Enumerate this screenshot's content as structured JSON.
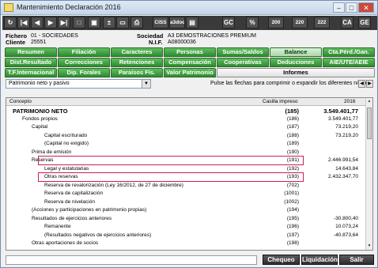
{
  "window": {
    "title": "Mantenimiento Declaración 2016",
    "min": "–",
    "max": "□",
    "close": "✕"
  },
  "toolbar": [
    {
      "name": "refresh-icon",
      "glyph": "↻"
    },
    {
      "name": "first-record-icon",
      "glyph": "|◀"
    },
    {
      "name": "prev-record-icon",
      "glyph": "◀"
    },
    {
      "name": "next-record-icon",
      "glyph": "▶"
    },
    {
      "name": "last-record-icon",
      "glyph": "▶|"
    },
    {
      "name": "new-document-icon",
      "glyph": "□"
    },
    {
      "name": "save-icon",
      "glyph": "▣"
    },
    {
      "name": "add-remove-icon",
      "glyph": "±"
    },
    {
      "name": "delete-icon",
      "glyph": "▭"
    },
    {
      "name": "print-icon",
      "glyph": "⎙"
    },
    {
      "name": "ciss-button",
      "glyph": "CISS"
    },
    {
      "name": "a3doc-button",
      "glyph": "a3doc"
    },
    {
      "name": "report-icon",
      "glyph": "▤"
    },
    {
      "name": "gc-button",
      "glyph": "GC"
    },
    {
      "name": "calculator-icon",
      "glyph": "%"
    },
    {
      "name": "form-200-button",
      "glyph": "200"
    },
    {
      "name": "form-220-button",
      "glyph": "220"
    },
    {
      "name": "form-222-button",
      "glyph": "222"
    },
    {
      "name": "ca-button",
      "glyph": "CA"
    },
    {
      "name": "ge-button",
      "glyph": "GE"
    }
  ],
  "info": {
    "fichero_label": "Fichero",
    "fichero_value": "01 - SOCIEDADES",
    "sociedad_label": "Sociedad",
    "sociedad_value": "A3 DEMOSTRACIONES PREMIUM",
    "cliente_label": "Cliente",
    "cliente_value": "25551",
    "nif_label": "N.I.F.",
    "nif_value": "A08000036"
  },
  "tabs": {
    "row1": [
      "Resumen",
      "Filiación",
      "Caracteres",
      "Personas",
      "Sumas/Saldos",
      "Balance",
      "Cta.Pérd./Gan."
    ],
    "row2": [
      "Dist.Resultado",
      "Correcciones",
      "Retenciones",
      "Compensación",
      "Cooperativas",
      "Deducciones",
      "AIE/UTE/AEIE"
    ],
    "row3": [
      "T.F.Internacional",
      "Dip. Forales",
      "Paraísos Fis.",
      "Valor Patrimonio",
      "Informes"
    ],
    "active": "Balance"
  },
  "selector": {
    "value": "Patrimonio neto y pasivo"
  },
  "hint": "Pulse las flechas para comprimir o expandir los diferentes niveles",
  "grid": {
    "headers": {
      "concepto": "Concepto",
      "casilla": "Casilla impreso",
      "year": "2016"
    },
    "rows": [
      {
        "indent": 8,
        "concepto": "PATRIMONIO NETO",
        "casilla": "(185)",
        "valor": "3.549.401,77",
        "bold": true
      },
      {
        "indent": 20,
        "concepto": "Fondos propios",
        "casilla": "(186)",
        "valor": "3.549.401,77"
      },
      {
        "indent": 32,
        "concepto": "Capital",
        "casilla": "(187)",
        "valor": "73.219,20"
      },
      {
        "indent": 48,
        "concepto": "Capital escriturado",
        "casilla": "(188)",
        "valor": "73.219,20"
      },
      {
        "indent": 48,
        "concepto": "(Capital no exigido)",
        "casilla": "(189)",
        "valor": ""
      },
      {
        "indent": 32,
        "concepto": "Prima de emisión",
        "casilla": "(190)",
        "valor": ""
      },
      {
        "indent": 32,
        "concepto": "Reservas",
        "casilla": "(191)",
        "valor": "2.446.991,54",
        "boxed": true
      },
      {
        "indent": 48,
        "concepto": "Legal y estatutarias",
        "casilla": "(192)",
        "valor": "14.643,84"
      },
      {
        "indent": 48,
        "concepto": "Otras reservas",
        "casilla": "(193)",
        "valor": "2.432.347,70",
        "boxed": true
      },
      {
        "indent": 48,
        "concepto": "Reserva de revalorización (Ley 16/2012, de 27 de diciembre)",
        "casilla": "(702)",
        "valor": ""
      },
      {
        "indent": 48,
        "concepto": "Reserva de capitalización",
        "casilla": "(1001)",
        "valor": ""
      },
      {
        "indent": 48,
        "concepto": "Reserva de nivelación",
        "casilla": "(1002)",
        "valor": ""
      },
      {
        "indent": 32,
        "concepto": "(Acciones y participaciones en patrimonio propias)",
        "casilla": "(194)",
        "valor": ""
      },
      {
        "indent": 32,
        "concepto": "Resultados de ejercicios anteriores",
        "casilla": "(195)",
        "valor": "-30.800,40"
      },
      {
        "indent": 48,
        "concepto": "Remanente",
        "casilla": "(196)",
        "valor": "10.073,24"
      },
      {
        "indent": 48,
        "concepto": "(Resultados negativos de ejercicios anteriores)",
        "casilla": "(197)",
        "valor": "-40.873,64"
      },
      {
        "indent": 32,
        "concepto": "Otras aportaciones de socios",
        "casilla": "(198)",
        "valor": ""
      }
    ]
  },
  "buttons": {
    "chequeo": "Chequeo",
    "liquidacion": "Liquidación",
    "salir": "Salir"
  },
  "colors": {
    "tab_green": "#2e8b2e",
    "highlight": "#d0195e",
    "toolbar": "#3a3a3a"
  }
}
